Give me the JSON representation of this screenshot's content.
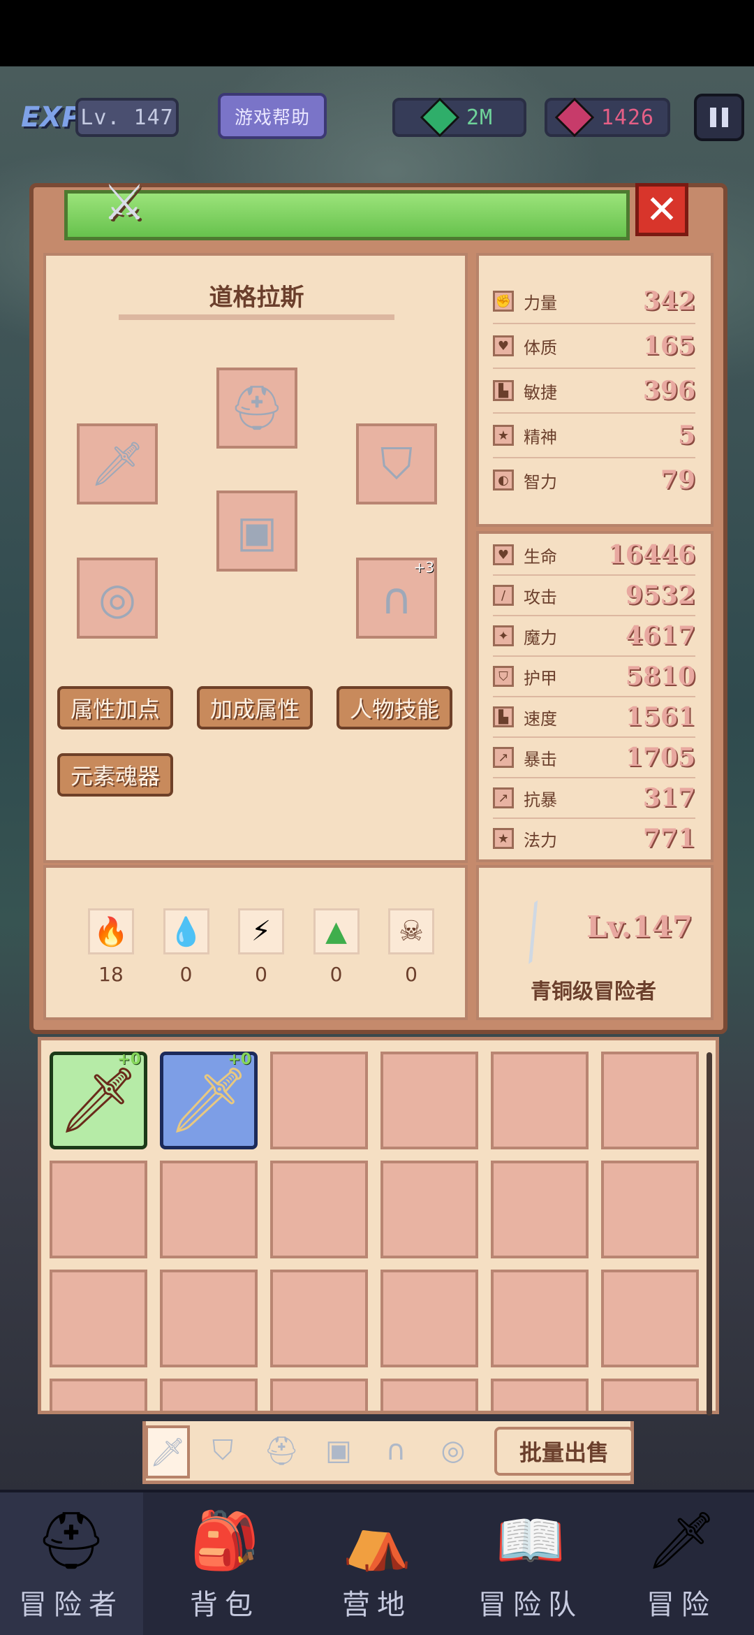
{
  "top_bar": {
    "exp_label": "EXP",
    "level": "Lv. 147",
    "help_label": "游戏帮助",
    "green_gems": "2M",
    "red_gems": "1426"
  },
  "hero": {
    "name": "道格拉斯"
  },
  "equipment": {
    "pants_enhance": "+3"
  },
  "buttons": {
    "attr_points": "属性加点",
    "bonus_attr": "加成属性",
    "char_skills": "人物技能",
    "element_soul": "元素魂器"
  },
  "attributes": [
    {
      "name": "力量",
      "value": "342",
      "icon": "fist"
    },
    {
      "name": "体质",
      "value": "165",
      "icon": "heart"
    },
    {
      "name": "敏捷",
      "value": "396",
      "icon": "boot"
    },
    {
      "name": "精神",
      "value": "5",
      "icon": "star"
    },
    {
      "name": "智力",
      "value": "79",
      "icon": "brain"
    }
  ],
  "stats": [
    {
      "name": "生命",
      "value": "16446",
      "icon": "heart"
    },
    {
      "name": "攻击",
      "value": "9532",
      "icon": "sword"
    },
    {
      "name": "魔力",
      "value": "4617",
      "icon": "wand"
    },
    {
      "name": "护甲",
      "value": "5810",
      "icon": "shield"
    },
    {
      "name": "速度",
      "value": "1561",
      "icon": "boot"
    },
    {
      "name": "暴击",
      "value": "1705",
      "icon": "crit"
    },
    {
      "name": "抗暴",
      "value": "317",
      "icon": "crit-resist"
    },
    {
      "name": "法力",
      "value": "771",
      "icon": "star"
    }
  ],
  "elements": [
    {
      "icon": "fire-icon",
      "value": "18",
      "glyph": "🔥"
    },
    {
      "icon": "water-icon",
      "value": "0",
      "glyph": "💧"
    },
    {
      "icon": "lightning-icon",
      "value": "0",
      "glyph": "⚡"
    },
    {
      "icon": "earth-icon",
      "value": "0",
      "glyph": "▲"
    },
    {
      "icon": "skull-icon",
      "value": "0",
      "glyph": "☠"
    }
  ],
  "rank": {
    "level": "Lv.147",
    "title": "青铜级冒险者"
  },
  "inventory": {
    "items": [
      {
        "enhance": "+0",
        "rarity": "green"
      },
      {
        "enhance": "+0",
        "rarity": "blue"
      }
    ],
    "sell_label": "批量出售"
  },
  "nav": [
    {
      "label": "冒险者",
      "icon": "helmet-icon",
      "glyph": "⛑"
    },
    {
      "label": "背包",
      "icon": "backpack-icon",
      "glyph": "🎒"
    },
    {
      "label": "营地",
      "icon": "camp-icon",
      "glyph": "⛺"
    },
    {
      "label": "冒险队",
      "icon": "book-icon",
      "glyph": "📖"
    },
    {
      "label": "冒险",
      "icon": "sword-icon",
      "glyph": "🗡"
    }
  ],
  "colors": {
    "accent_green": "#67c24d",
    "close_red": "#d8352b",
    "panel_bg": "#f5dfc3",
    "stat_value": "#e8a8a0"
  }
}
